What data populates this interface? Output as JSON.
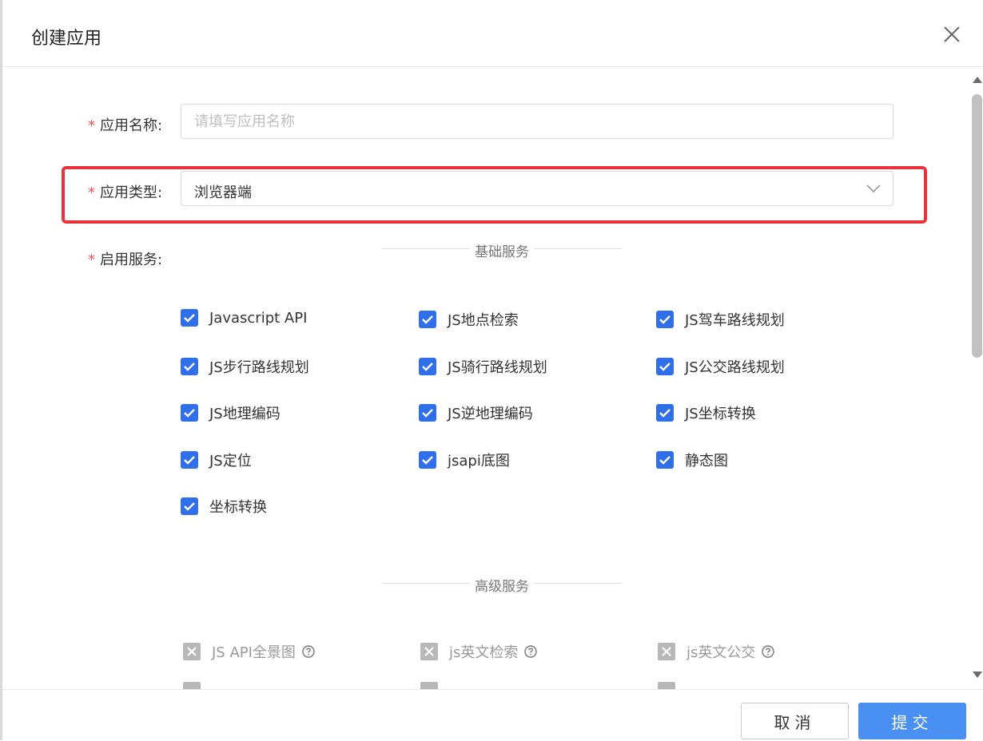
{
  "dialog": {
    "title": "创建应用"
  },
  "form": {
    "required_mark": "*",
    "app_name": {
      "label": "应用名称:",
      "value": "",
      "placeholder": "请填写应用名称"
    },
    "app_type": {
      "label": "应用类型:",
      "value": "浏览器端"
    },
    "services": {
      "label": "启用服务:"
    }
  },
  "basic_services": {
    "title": "基础服务",
    "items": [
      {
        "label": "Javascript API",
        "checked": true
      },
      {
        "label": "JS地点检索",
        "checked": true
      },
      {
        "label": "JS驾车路线规划",
        "checked": true
      },
      {
        "label": "JS步行路线规划",
        "checked": true
      },
      {
        "label": "JS骑行路线规划",
        "checked": true
      },
      {
        "label": "JS公交路线规划",
        "checked": true
      },
      {
        "label": "JS地理编码",
        "checked": true
      },
      {
        "label": "JS逆地理编码",
        "checked": true
      },
      {
        "label": "JS坐标转换",
        "checked": true
      },
      {
        "label": "JS定位",
        "checked": true
      },
      {
        "label": "jsapi底图",
        "checked": true
      },
      {
        "label": "静态图",
        "checked": true
      },
      {
        "label": "坐标转换",
        "checked": true
      }
    ]
  },
  "advanced_services": {
    "title": "高级服务",
    "items": [
      {
        "label": "JS API全景图",
        "disabled": true
      },
      {
        "label": "js英文检索",
        "disabled": true
      },
      {
        "label": "js英文公交",
        "disabled": true
      }
    ]
  },
  "footer": {
    "cancel_label": "取消",
    "submit_label": "提交"
  },
  "colors": {
    "checkbox": "#2f6fea",
    "highlight": "#e8313a",
    "primary_button": "#4a90f2",
    "required": "#ff4d4f"
  }
}
